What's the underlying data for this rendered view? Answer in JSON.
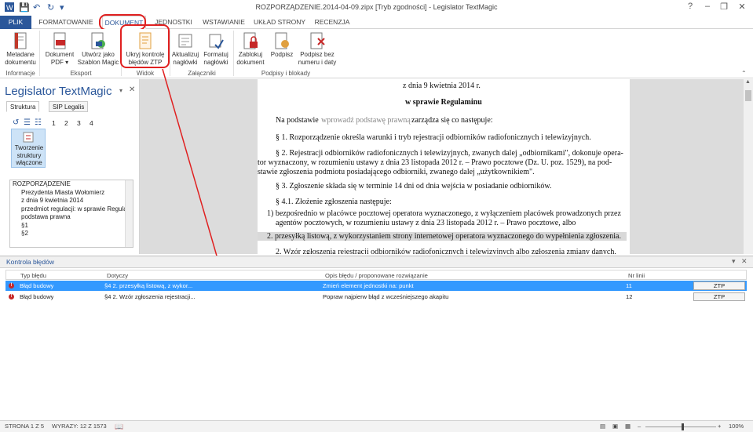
{
  "window": {
    "title": "ROZPORZĄDZENIE.2014-04-09.zipx [Tryb zgodności] - Legislator TextMagic"
  },
  "qat": {
    "save_icon": "save-icon",
    "undo_icon": "undo-icon",
    "redo_icon": "redo-icon"
  },
  "tabs": [
    "PLIK",
    "FORMATOWANIE",
    "DOKUMENT",
    "JEDNOSTKI",
    "WSTAWIANIE",
    "UKŁAD STRONY",
    "RECENZJA"
  ],
  "ribbon": {
    "buttons": {
      "metadane": "Metadane\ndokumentu",
      "dokument_pdf": "Dokument\nPDF ▾",
      "szablon": "Utwórz jako\nSzablon Magic",
      "ukryj": "Ukryj kontrolę\nbłędów ZTP",
      "aktualizuj": "Aktualizuj\nnagłówki",
      "formatuj": "Formatuj\nnagłówki",
      "zablokuj": "Zablokuj\ndokument",
      "podpisz": "Podpisz",
      "podpisz_bez": "Podpisz bez\nnumeru i daty"
    },
    "groups": {
      "informacje": "Informacje",
      "eksport": "Eksport",
      "widok": "Widok",
      "zalaczniki": "Załączniki",
      "podpisy": "Podpisy i blokady"
    }
  },
  "leftpane": {
    "title": "Legislator TextMagic",
    "tab_struktura": "Struktura",
    "tab_sip": "SIP Legalis",
    "levels": [
      "1",
      "2",
      "3",
      "4"
    ],
    "struct_button": "Tworzenie\nstruktury\nwłączone",
    "tree": [
      "ROZPORZĄDZENIE",
      "Prezydenta Miasta Wołomierz",
      "z dnia 9 kwietnia 2014",
      "przedmiot regulacji: w sprawie Regulamin",
      "podstawa prawna",
      "§1",
      "§2"
    ]
  },
  "document": {
    "lines": [
      "z dnia 9 kwietnia 2014 r.",
      "w sprawie Regulaminu",
      "Na podstawie",
      "wprowadź podstawę prawną",
      "zarządza się co następuje:",
      "§ 1. Rozporządzenie określa warunki i tryb rejestracji odbiorników radiofonicznych i telewizyjnych.",
      "§ 2. Rejestracji odbiorników radiofonicznych i telewizyjnych, zwanych dalej „odbiornikami\", dokonuje opera-",
      "tor wyznaczony, w rozumieniu ustawy z dnia 23 listopada 2012 r. – Prawo  pocztowe (Dz. U. poz. 1529), na pod-",
      "stawie zgłoszenia podmiotu  posiadającego odbiorniki, zwanego dalej „użytkownikiem\".",
      "§ 3. Zgłoszenie  składa się w terminie 14 dni od dnia wejścia w posiadanie odbiorników.",
      "§ 4.1. Złożenie zgłoszenia  następuje:",
      "1) bezpośrednio w placówce pocztowej operatora wyznaczonego, z wyłączeniem placówek prowadzonych przez",
      "agentów pocztowych, w rozumieniu ustawy z dnia 23 listopada 2012 r. – Prawo pocztowe, albo",
      "2. przesyłką listową, z wykorzystaniem strony internetowej operatora wyznaczonego do wypełnienia zgłoszenia.",
      "2. Wzór zgłoszenia rejestracji odbiorników radiofonicznych i telewizyjnych albo zgłoszenia zmiany danych,"
    ]
  },
  "errors": {
    "title": "Kontrola błędów",
    "columns": [
      "Typ błędu",
      "Dotyczy",
      "Opis błędu / proponowane rozwiązanie",
      "Nr linii"
    ],
    "rows": [
      {
        "type": "Błąd budowy",
        "target": "§4 2. przesyłką listową, z wykor...",
        "desc": "Zmień element jednostki na: punkt",
        "line": "11",
        "action": "ZTP"
      },
      {
        "type": "Błąd budowy",
        "target": "§4 2. Wzór zgłoszenia rejestracji...",
        "desc": "Popraw najpierw błąd z wcześniejszego akapitu",
        "line": "12",
        "action": "ZTP"
      }
    ]
  },
  "status": {
    "page": "STRONA 1 Z 5",
    "words": "WYRAZY: 12 Z 1573",
    "zoom": "100%"
  },
  "colors": {
    "accent": "#2b579a",
    "highlight_red": "#e02020",
    "selection": "#3399ff"
  }
}
